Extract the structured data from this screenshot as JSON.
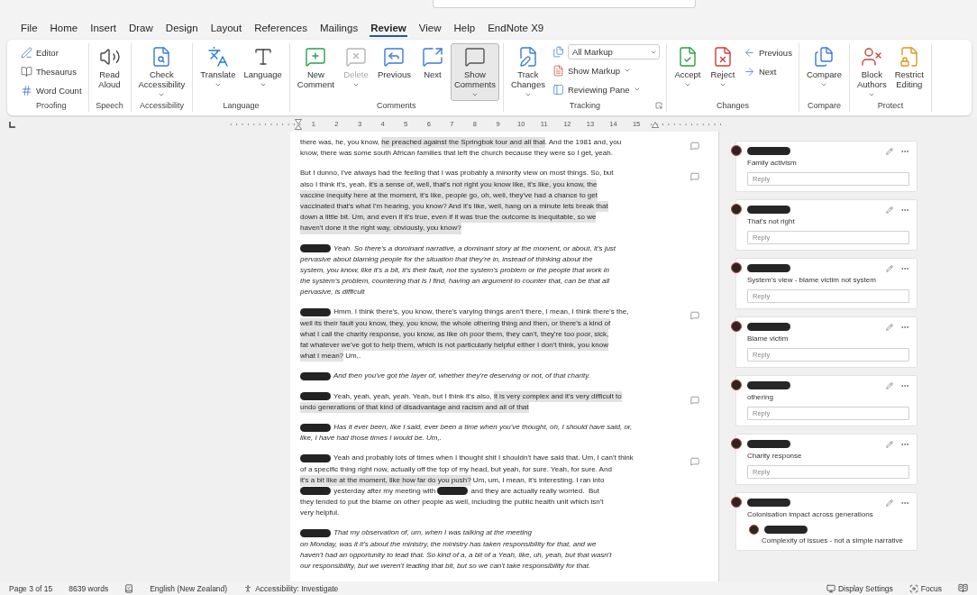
{
  "menu_tabs": [
    {
      "label": "File",
      "selected": false
    },
    {
      "label": "Home",
      "selected": false
    },
    {
      "label": "Insert",
      "selected": false
    },
    {
      "label": "Draw",
      "selected": false
    },
    {
      "label": "Design",
      "selected": false
    },
    {
      "label": "Layout",
      "selected": false
    },
    {
      "label": "References",
      "selected": false
    },
    {
      "label": "Mailings",
      "selected": false
    },
    {
      "label": "Review",
      "selected": true
    },
    {
      "label": "View",
      "selected": false
    },
    {
      "label": "Help",
      "selected": false
    },
    {
      "label": "EndNote X9",
      "selected": false
    }
  ],
  "ribbon": [
    {
      "label": "Proofing",
      "launcher": false,
      "items": [
        {
          "kind": "stack",
          "items": [
            {
              "kind": "small",
              "label": "Editor",
              "dropdown": false
            },
            {
              "kind": "small",
              "label": "Thesaurus",
              "dropdown": false
            },
            {
              "kind": "small",
              "label": "Word Count",
              "dropdown": false
            }
          ]
        }
      ]
    },
    {
      "label": "Speech",
      "launcher": false,
      "items": [
        {
          "kind": "large",
          "label": "Read\nAloud",
          "dropdown": false
        }
      ]
    },
    {
      "label": "Accessibility",
      "launcher": false,
      "items": [
        {
          "kind": "large",
          "label": "Check\nAccessibility",
          "dropdown": true
        }
      ]
    },
    {
      "label": "Language",
      "launcher": false,
      "items": [
        {
          "kind": "large",
          "label": "Translate",
          "dropdown": true
        },
        {
          "kind": "large",
          "label": "Language",
          "dropdown": true
        }
      ]
    },
    {
      "label": "Comments",
      "launcher": false,
      "items": [
        {
          "kind": "large",
          "label": "New\nComment",
          "dropdown": false,
          "disabled": false,
          "pressed": false
        },
        {
          "kind": "large",
          "label": "Delete",
          "dropdown": true,
          "disabled": true,
          "pressed": false
        },
        {
          "kind": "large",
          "label": "Previous",
          "dropdown": false,
          "disabled": false,
          "pressed": false
        },
        {
          "kind": "large",
          "label": "Next",
          "dropdown": false,
          "disabled": false,
          "pressed": false
        },
        {
          "kind": "large",
          "label": "Show\nComments",
          "dropdown": true,
          "disabled": false,
          "pressed": true
        }
      ]
    },
    {
      "label": "Tracking",
      "launcher": true,
      "items": [
        {
          "kind": "large",
          "label": "Track\nChanges",
          "dropdown": true
        },
        {
          "kind": "stack",
          "items": [
            {
              "kind": "select",
              "value": "All Markup"
            },
            {
              "kind": "small",
              "label": "Show Markup",
              "dropdown": true
            },
            {
              "kind": "small",
              "label": "Reviewing Pane",
              "dropdown": true
            }
          ]
        }
      ]
    },
    {
      "label": "Changes",
      "launcher": false,
      "items": [
        {
          "kind": "large",
          "label": "Accept",
          "dropdown": true
        },
        {
          "kind": "large",
          "label": "Reject",
          "dropdown": true
        },
        {
          "kind": "stack",
          "items": [
            {
              "kind": "small",
              "label": "Previous",
              "dropdown": false
            },
            {
              "kind": "small",
              "label": "Next",
              "dropdown": false
            }
          ]
        }
      ]
    },
    {
      "label": "Compare",
      "launcher": false,
      "items": [
        {
          "kind": "large",
          "label": "Compare",
          "dropdown": true
        }
      ]
    },
    {
      "label": "Protect",
      "launcher": false,
      "items": [
        {
          "kind": "large",
          "label": "Block\nAuthors",
          "dropdown": true
        },
        {
          "kind": "large",
          "label": "Restrict\nEditing",
          "dropdown": false
        }
      ]
    }
  ],
  "ruler": {
    "numbers": [
      "1",
      "2",
      "3",
      "4",
      "5",
      "6",
      "7",
      "8",
      "9",
      "10",
      "11",
      "12",
      "13",
      "14",
      "15"
    ]
  },
  "paragraphs": [
    {
      "italic": false,
      "comment_marker": true,
      "lines": [
        {
          "segments": [
            {
              "kind": "text",
              "text": "there was, he, you know, ",
              "highlighted": false
            },
            {
              "kind": "text",
              "text": "he preached against the Springbok tour and all that",
              "highlighted": true
            },
            {
              "kind": "text",
              "text": ". And the 1981 and, you",
              "highlighted": false
            }
          ]
        },
        {
          "segments": [
            {
              "kind": "text",
              "text": "know, there was some south African families that left the church because they were so I get, yeah.",
              "highlighted": false
            }
          ]
        }
      ]
    },
    {
      "italic": false,
      "comment_marker": true,
      "lines": [
        {
          "segments": [
            {
              "kind": "text",
              "text": "But I dunno, I've always had the feeling that I was probably a minority view on most things. So, but",
              "highlighted": false
            }
          ]
        },
        {
          "segments": [
            {
              "kind": "text",
              "text": "also I think it's, yeah, ",
              "highlighted": false
            },
            {
              "kind": "text",
              "text": "it's a sense of, well, that's not right you know like, it's like, you know, the",
              "highlighted": true
            }
          ]
        },
        {
          "segments": [
            {
              "kind": "text",
              "text": "vaccine inequity here at the moment, it's like, people go, oh, well, they've had a chance to get",
              "highlighted": true
            }
          ]
        },
        {
          "segments": [
            {
              "kind": "text",
              "text": "vaccinated that's what I'm hearing, you know? And it's like, well, hang on a minute lets break that",
              "highlighted": true
            }
          ]
        },
        {
          "segments": [
            {
              "kind": "text",
              "text": "down a little bit. Um, and even if it's true, even if it was true the outcome is inequitable, so we",
              "highlighted": true
            }
          ]
        },
        {
          "segments": [
            {
              "kind": "text",
              "text": "haven't done it the right way, obviously, you know?",
              "highlighted": true
            }
          ]
        }
      ]
    },
    {
      "italic": true,
      "comment_marker": false,
      "lines": [
        {
          "segments": [
            {
              "kind": "redaction"
            },
            {
              "kind": "text",
              "text": " Yeah. So there's a dominant narrative, a dominant story at the moment, or about, it's just",
              "highlighted": false
            }
          ]
        },
        {
          "segments": [
            {
              "kind": "text",
              "text": "pervasive about blaming people for the situation that they're in, instead of thinking about the",
              "highlighted": false
            }
          ]
        },
        {
          "segments": [
            {
              "kind": "text",
              "text": "system, you know, like it's a bit, it's their fault, not the system's problem or the people that work in",
              "highlighted": false
            }
          ]
        },
        {
          "segments": [
            {
              "kind": "text",
              "text": "the system's problem, countering that is I find, having an argument to counter that, can be that all",
              "highlighted": false
            }
          ]
        },
        {
          "segments": [
            {
              "kind": "text",
              "text": "pervasive, is difficult",
              "highlighted": false
            }
          ]
        }
      ]
    },
    {
      "italic": false,
      "comment_marker": true,
      "lines": [
        {
          "segments": [
            {
              "kind": "redaction"
            },
            {
              "kind": "text",
              "text": " Hmm. I think there's, you know, there's varying things aren't there, I mean, I think there's the,",
              "highlighted": false
            }
          ]
        },
        {
          "segments": [
            {
              "kind": "text",
              "text": "well its their fault you know, they, you know, the whole othering thing and then, or there's a kind of",
              "highlighted": true
            }
          ]
        },
        {
          "segments": [
            {
              "kind": "text",
              "text": "what I call the charity response, you know, as like oh poor them, they can't, they're too poor, sick,",
              "highlighted": true
            }
          ]
        },
        {
          "segments": [
            {
              "kind": "text",
              "text": "fat whatever we've got to help them, which is not particularly helpful either I don't think, you know",
              "highlighted": true
            }
          ]
        },
        {
          "segments": [
            {
              "kind": "text",
              "text": "what I mean?",
              "highlighted": true
            },
            {
              "kind": "text",
              "text": " Um,.",
              "highlighted": false
            }
          ]
        }
      ]
    },
    {
      "italic": true,
      "comment_marker": false,
      "lines": [
        {
          "segments": [
            {
              "kind": "redaction"
            },
            {
              "kind": "text",
              "text": " And then you've got the layer of, whether they're deserving or not, of that charity.",
              "highlighted": false
            }
          ]
        }
      ]
    },
    {
      "italic": false,
      "comment_marker": true,
      "lines": [
        {
          "segments": [
            {
              "kind": "redaction"
            },
            {
              "kind": "text",
              "text": " Yeah, yeah, yeah, yeah. Yeah, but I think it's also, ",
              "highlighted": false
            },
            {
              "kind": "text",
              "text": "it is very complex and it's very difficult to",
              "highlighted": true
            }
          ]
        },
        {
          "segments": [
            {
              "kind": "text",
              "text": "undo generations of that kind of disadvantage and racism and all of that",
              "highlighted": true
            }
          ]
        }
      ]
    },
    {
      "italic": true,
      "comment_marker": false,
      "lines": [
        {
          "segments": [
            {
              "kind": "redaction"
            },
            {
              "kind": "text",
              "text": " Has it ever been, like I said, ever been a time when you've thought, oh, I should have said, or,",
              "highlighted": false
            }
          ]
        },
        {
          "segments": [
            {
              "kind": "text",
              "text": "like, I have had those times I would be. Um,.",
              "highlighted": false
            }
          ]
        }
      ]
    },
    {
      "italic": false,
      "comment_marker": true,
      "lines": [
        {
          "segments": [
            {
              "kind": "redaction"
            },
            {
              "kind": "text",
              "text": " Yeah and probably lots of times when I thought shit I shouldn't have said that. Um, I can't think",
              "highlighted": false
            }
          ]
        },
        {
          "segments": [
            {
              "kind": "text",
              "text": "of a specific thing right now, actually off the top of my head, but yeah, for sure. Yeah, for sure. And",
              "highlighted": false
            }
          ]
        },
        {
          "segments": [
            {
              "kind": "text",
              "text": "it's a bit like at the moment, like how far do you push?",
              "highlighted": true
            },
            {
              "kind": "text",
              "text": " Um, um, I mean, it's interesting. I ran into",
              "highlighted": false
            }
          ]
        },
        {
          "segments": [
            {
              "kind": "redaction"
            },
            {
              "kind": "text",
              "text": " yesterday after my meeting with ",
              "highlighted": false
            },
            {
              "kind": "redaction"
            },
            {
              "kind": "text",
              "text": " and they are actually really worried.  But",
              "highlighted": false
            }
          ]
        },
        {
          "segments": [
            {
              "kind": "text",
              "text": "they tended to put the blame on other people as well, including the public health unit which isn't",
              "highlighted": false
            }
          ]
        },
        {
          "segments": [
            {
              "kind": "text",
              "text": "very helpful.",
              "highlighted": false
            }
          ]
        }
      ]
    },
    {
      "italic": true,
      "comment_marker": false,
      "lines": [
        {
          "segments": [
            {
              "kind": "redaction"
            },
            {
              "kind": "text",
              "text": " That my observation of, um, when I was talking at the meeting",
              "highlighted": false
            }
          ]
        },
        {
          "segments": [
            {
              "kind": "text",
              "text": "on Monday, was it it's about the ministry, the ministry has taken responsibility for that, and we",
              "highlighted": false
            }
          ]
        },
        {
          "segments": [
            {
              "kind": "text",
              "text": "haven't had an opportunity to lead that. So kind of a, a bit of a Yeah, like, uh, yeah, but that wasn't",
              "highlighted": false
            }
          ]
        },
        {
          "segments": [
            {
              "kind": "text",
              "text": "our responsibility, but we weren't leading that bit, but so we can't take responsibility for that.",
              "highlighted": false
            }
          ]
        }
      ]
    }
  ],
  "comments": [
    {
      "text": "Family activism",
      "reply_placeholder": "Reply"
    },
    {
      "text": "That's not right",
      "reply_placeholder": "Reply"
    },
    {
      "text": "System's view - blame victim not system",
      "reply_placeholder": "Reply"
    },
    {
      "text": "Blame victim",
      "reply_placeholder": "Reply"
    },
    {
      "text": "othering",
      "reply_placeholder": "Reply"
    },
    {
      "text": "Charity response",
      "reply_placeholder": "Reply"
    },
    {
      "text": "Colonisation impact across generations",
      "replies": [
        {
          "text": "Complexity of issues - not a simple narrative"
        }
      ]
    }
  ],
  "status_bar": {
    "page": "Page 3 of 15",
    "words": "8639 words",
    "language": "English (New Zealand)",
    "accessibility": "Accessibility: Investigate",
    "display_settings": "Display Settings",
    "focus": "Focus"
  }
}
